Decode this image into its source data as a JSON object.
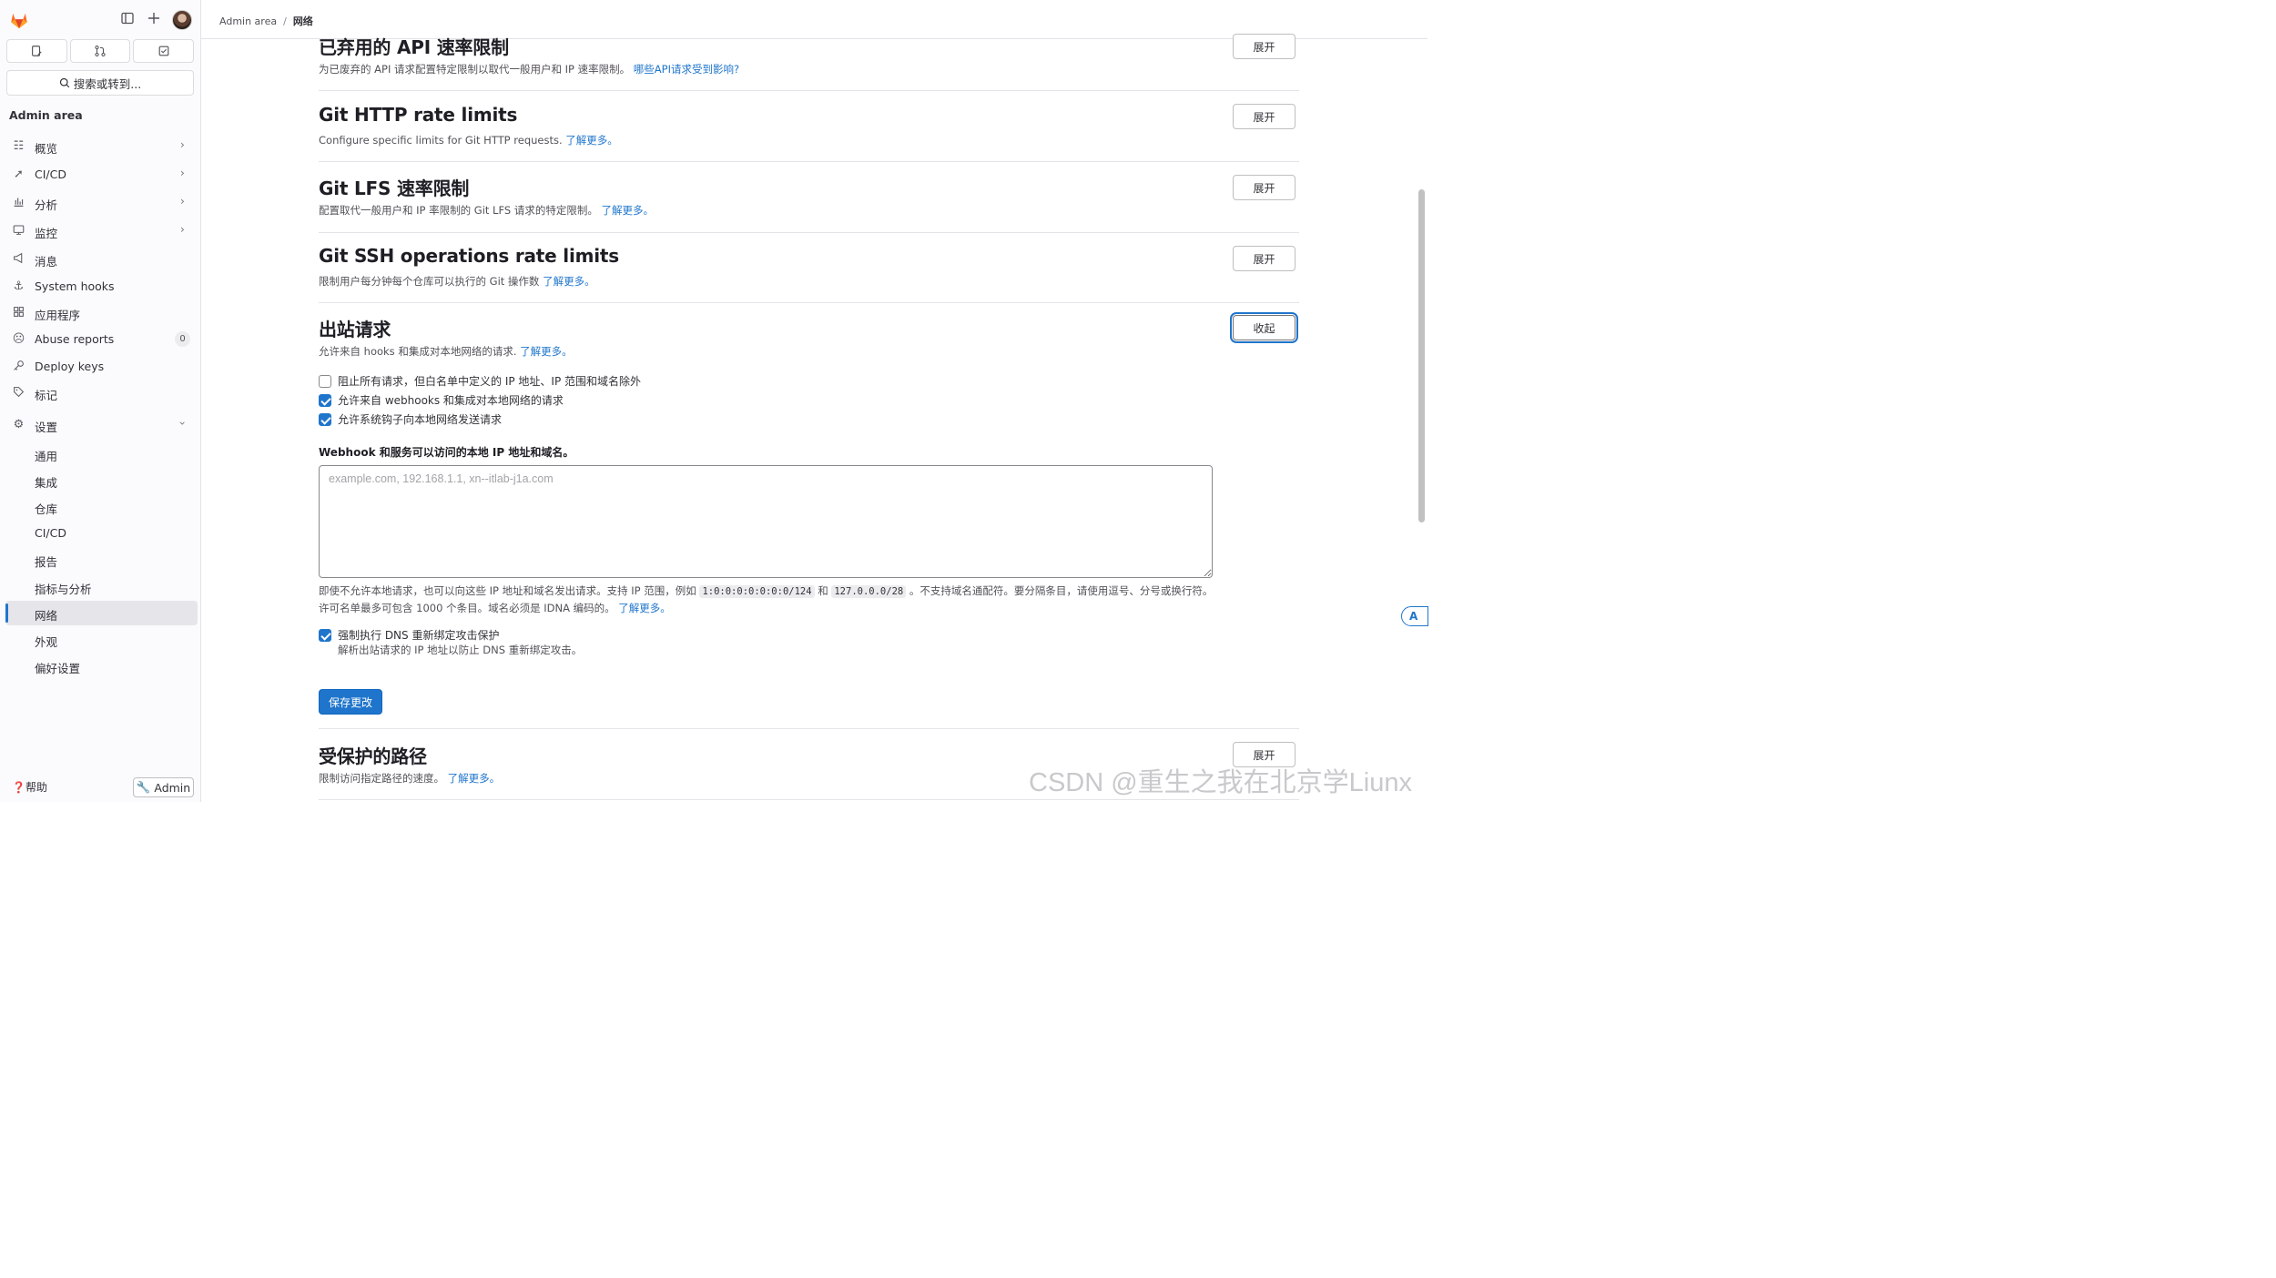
{
  "sidebar": {
    "title": "Admin area",
    "search_placeholder": "搜索或转到...",
    "nav": [
      {
        "label": "概览",
        "icon": "overview-icon"
      },
      {
        "label": "CI/CD",
        "icon": "rocket-icon"
      },
      {
        "label": "分析",
        "icon": "chart-icon"
      },
      {
        "label": "监控",
        "icon": "monitor-icon"
      },
      {
        "label": "消息",
        "icon": "megaphone-icon"
      },
      {
        "label": "System hooks",
        "icon": "anchor-icon"
      },
      {
        "label": "应用程序",
        "icon": "apps-icon"
      },
      {
        "label": "Abuse reports",
        "icon": "abuse-icon",
        "badge": "0"
      },
      {
        "label": "Deploy keys",
        "icon": "key-icon"
      },
      {
        "label": "标记",
        "icon": "label-icon"
      },
      {
        "label": "设置",
        "icon": "settings-icon"
      }
    ],
    "settings_sub": [
      "通用",
      "集成",
      "仓库",
      "CI/CD",
      "报告",
      "指标与分析",
      "网络",
      "外观",
      "偏好设置"
    ],
    "help": "帮助",
    "admin": "Admin"
  },
  "breadcrumb": {
    "root": "Admin area",
    "current": "网络"
  },
  "sections": {
    "deprecated": {
      "title": "已弃用的 API 速率限制",
      "desc": "为已废弃的 API 请求配置特定限制以取代一般用户和 IP 速率限制。",
      "link": "哪些API请求受到影响?",
      "button": "展开"
    },
    "git_http": {
      "title": "Git HTTP rate limits",
      "desc": "Configure specific limits for Git HTTP requests.",
      "link": "了解更多。",
      "button": "展开"
    },
    "git_lfs": {
      "title": "Git LFS 速率限制",
      "desc": "配置取代一般用户和 IP 率限制的 Git LFS 请求的特定限制。",
      "link": "了解更多。",
      "button": "展开"
    },
    "git_ssh": {
      "title": "Git SSH operations rate limits",
      "desc": "限制用户每分钟每个仓库可以执行的 Git 操作数",
      "link": "了解更多。",
      "button": "展开"
    },
    "outbound": {
      "title": "出站请求",
      "desc": "允许来自 hooks 和集成对本地网络的请求.",
      "link": "了解更多。",
      "button": "收起",
      "checks": [
        {
          "label": "阻止所有请求，但白名单中定义的 IP 地址、IP 范围和域名除外",
          "checked": false
        },
        {
          "label": "允许来自 webhooks 和集成对本地网络的请求",
          "checked": true
        },
        {
          "label": "允许系统钩子向本地网络发送请求",
          "checked": true
        }
      ],
      "field_label": "Webhook 和服务可以访问的本地 IP 地址和域名。",
      "placeholder": "example.com, 192.168.1.1, xn--itlab-j1a.com",
      "help_a": "即使不允许本地请求，也可以向这些 IP 地址和域名发出请求。支持 IP 范围，例如",
      "code1": "1:0:0:0:0:0:0:0/124",
      "help_and": "和",
      "code2": "127.0.0.0/28",
      "help_b": "。不支持域名通配符。要分隔条目，请使用逗号、分号或换行符。许可名单最多可包含 1000 个条目。域名必须是 IDNA 编码的。",
      "help_link": "了解更多。",
      "dns_label": "强制执行 DNS 重新绑定攻击保护",
      "dns_checked": true,
      "dns_desc": "解析出站请求的 IP 地址以防止 DNS 重新绑定攻击。",
      "save": "保存更改"
    },
    "protected": {
      "title": "受保护的路径",
      "desc": "限制访问指定路径的速度。",
      "link": "了解更多。",
      "button": "展开"
    }
  },
  "watermark": "CSDN @重生之我在北京学Liunx",
  "translate_fab": "A"
}
